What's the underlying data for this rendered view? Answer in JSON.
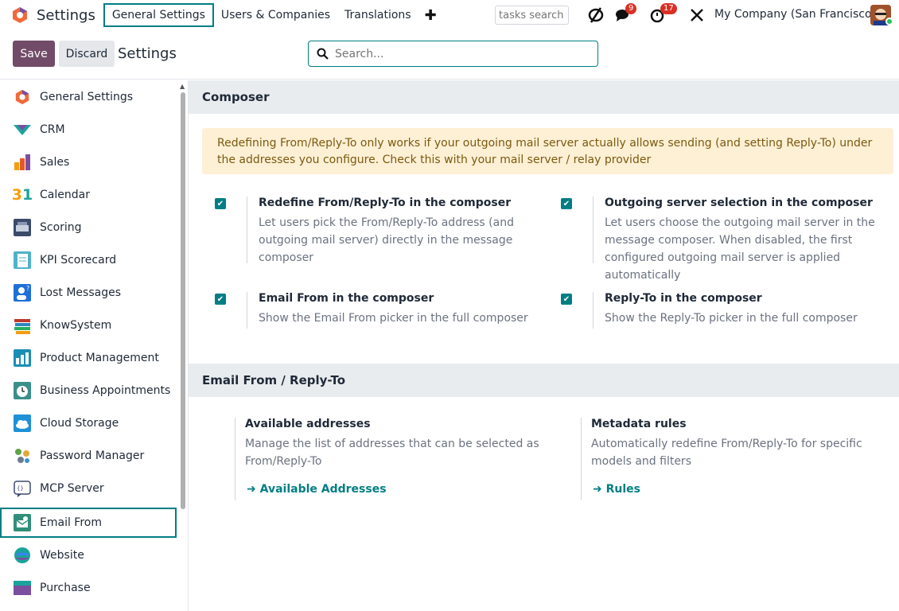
{
  "navbar": {
    "app_name": "Settings",
    "menu": [
      "General Settings",
      "Users & Companies",
      "Translations"
    ],
    "tasks_search_placeholder": "tasks search",
    "messages_count": "9",
    "activities_count": "17",
    "company": "My Company (San Francisco)"
  },
  "control": {
    "save_label": "Save",
    "discard_label": "Discard",
    "title": "Settings",
    "search_placeholder": "Search..."
  },
  "sidebar": {
    "items": [
      {
        "label": "General Settings",
        "icon": "settings-logo-icon"
      },
      {
        "label": "CRM",
        "icon": "crm-icon"
      },
      {
        "label": "Sales",
        "icon": "sales-icon"
      },
      {
        "label": "Calendar",
        "icon": "calendar-icon"
      },
      {
        "label": "Scoring",
        "icon": "scoring-icon"
      },
      {
        "label": "KPI Scorecard",
        "icon": "kpi-scorecard-icon"
      },
      {
        "label": "Lost Messages",
        "icon": "lost-messages-icon"
      },
      {
        "label": "KnowSystem",
        "icon": "knowsystem-icon"
      },
      {
        "label": "Product Management",
        "icon": "product-management-icon"
      },
      {
        "label": "Business Appointments",
        "icon": "appointments-icon"
      },
      {
        "label": "Cloud Storage",
        "icon": "cloud-storage-icon"
      },
      {
        "label": "Password Manager",
        "icon": "password-manager-icon"
      },
      {
        "label": "MCP Server",
        "icon": "mcp-server-icon"
      },
      {
        "label": "Email From",
        "icon": "email-from-icon"
      },
      {
        "label": "Website",
        "icon": "website-icon"
      },
      {
        "label": "Purchase",
        "icon": "purchase-icon"
      }
    ],
    "active": "Email From"
  },
  "composer": {
    "heading": "Composer",
    "alert": "Redefining From/Reply-To only works if your outgoing mail server actually allows sending (and setting Reply-To) under the addresses you configure. Check this with your mail server / relay provider",
    "settings": [
      {
        "title": "Redefine From/Reply-To in the composer",
        "desc": "Let users pick the From/Reply-To address (and outgoing mail server) directly in the message composer",
        "checked": true
      },
      {
        "title": "Outgoing server selection in the composer",
        "desc": "Let users choose the outgoing mail server in the message composer. When disabled, the first configured outgoing mail server is applied automatically",
        "checked": true
      },
      {
        "title": "Email From in the composer",
        "desc": "Show the Email From picker in the full composer",
        "checked": true
      },
      {
        "title": "Reply-To in the composer",
        "desc": "Show the Reply-To picker in the full composer",
        "checked": true
      }
    ]
  },
  "from_reply": {
    "heading": "Email From / Reply-To",
    "blocks": [
      {
        "title": "Available addresses",
        "desc": "Manage the list of addresses that can be selected as From/Reply-To",
        "link": "Available Addresses"
      },
      {
        "title": "Metadata rules",
        "desc": "Automatically redefine From/Reply-To for specific models and filters",
        "link": "Rules"
      }
    ]
  },
  "colors": {
    "accent": "#017e84",
    "primary": "#714b67"
  }
}
